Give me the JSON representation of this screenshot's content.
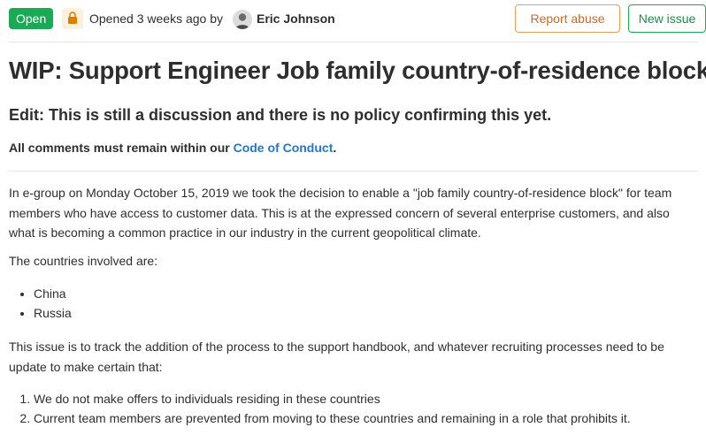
{
  "header": {
    "status": "Open",
    "opened_text": "Opened 3 weeks ago by",
    "author": "Eric Johnson",
    "report_abuse": "Report abuse",
    "new_issue": "New issue"
  },
  "issue": {
    "title": "WIP: Support Engineer Job family country-of-residence block",
    "edit_note": "Edit: This is still a discussion and there is no policy confirming this yet.",
    "coc_prefix": "All comments must remain within our ",
    "coc_link": "Code of Conduct",
    "coc_suffix": ".",
    "paragraph1": "In e-group on Monday October 15, 2019 we took the decision to enable a \"job family country-of-residence block\" for team members who have access to customer data. This is at the expressed concern of several enterprise customers, and also what is becoming a common practice in our industry in the current geopolitical climate.",
    "countries_intro": "The countries involved are:",
    "countries": [
      "China",
      "Russia"
    ],
    "paragraph2": "This issue is to track the addition of the process to the support handbook, and whatever recruiting processes need to be update to make certain that:",
    "conditions": [
      "We do not make offers to individuals residing in these countries",
      "Current team members are prevented from moving to these countries and remaining in a role that prohibits it."
    ]
  },
  "colors": {
    "open_green": "#1aaa55",
    "link_blue": "#1f78d1",
    "report_orange": "#d2691e"
  },
  "icons": {
    "lock": "lock-icon",
    "avatar": "user-avatar"
  }
}
